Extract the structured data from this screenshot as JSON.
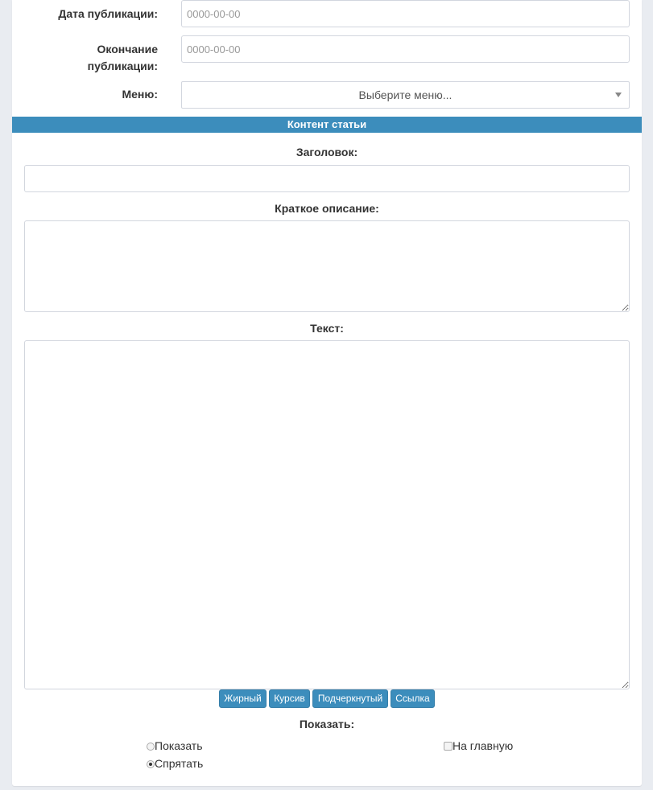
{
  "form": {
    "pub_date": {
      "label": "Дата публикации:",
      "placeholder": "0000-00-00"
    },
    "pub_end": {
      "label_line1": "Окончание",
      "label_line2": "публикации:",
      "placeholder": "0000-00-00"
    },
    "menu": {
      "label": "Меню:",
      "selected": "Выберите меню..."
    }
  },
  "content": {
    "section_title": "Контент статьи",
    "title_label": "Заголовок:",
    "summary_label": "Краткое описание:",
    "text_label": "Текст:",
    "buttons": [
      "Жирный",
      "Курсив",
      "Подчеркнутый",
      "Ссылка"
    ],
    "show_label": "Показать:",
    "radio_show": "Показать",
    "radio_hide": "Спрятать",
    "checkbox_main": "На главную"
  },
  "colors": {
    "accent": "#3c8dbc",
    "background": "#e9ecf1"
  }
}
